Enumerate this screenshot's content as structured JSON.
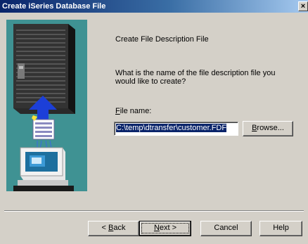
{
  "window": {
    "title": "Create iSeries Database File",
    "close_glyph": "×"
  },
  "content": {
    "heading": "Create File Description File",
    "question": "What is the name of the file description file you would like to create?",
    "file_label_accel": "F",
    "file_label_rest": "ile name:",
    "file_name_value": "C:\\temp\\dtransfer\\customer.FDF"
  },
  "buttons": {
    "browse_accel": "B",
    "browse_rest": "rowse...",
    "back_prefix": "< ",
    "back_accel": "B",
    "back_rest": "ack",
    "next_accel": "N",
    "next_rest": "ext >",
    "cancel": "Cancel",
    "help": "Help"
  },
  "colors": {
    "title_bar_start": "#0a246a",
    "title_bar_end": "#a6caf0",
    "dialog_face": "#d4d0c8",
    "illustration_bg": "#3f9293",
    "selection": "#0a246a"
  }
}
